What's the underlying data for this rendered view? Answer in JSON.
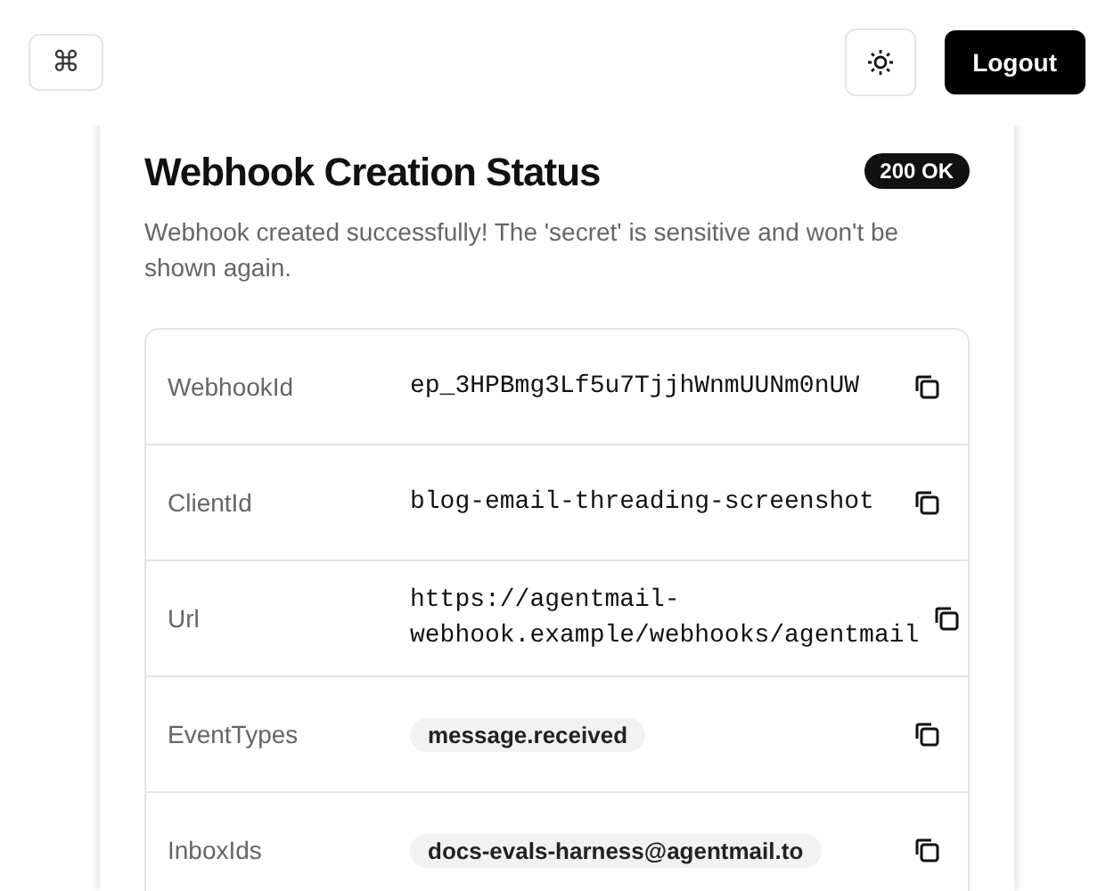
{
  "header": {
    "command_button": "⌘",
    "logout_button": "Logout"
  },
  "card": {
    "title": "Webhook Creation Status",
    "status_badge": "200 OK",
    "description": "Webhook created successfully! The 'secret' is sensitive and won't be shown again.",
    "fields": [
      {
        "label": "WebhookId",
        "kind": "code",
        "value": "ep_3HPBmg3Lf5u7TjjhWnmUUNm0nUW"
      },
      {
        "label": "ClientId",
        "kind": "code",
        "value": "blog-email-threading-screenshot"
      },
      {
        "label": "Url",
        "kind": "code",
        "value": "https://agentmail-webhook.example/webhooks/agentmail"
      },
      {
        "label": "EventTypes",
        "kind": "chip",
        "value": "message.received"
      },
      {
        "label": "InboxIds",
        "kind": "chip",
        "value": "docs-evals-harness@agentmail.to"
      }
    ]
  }
}
